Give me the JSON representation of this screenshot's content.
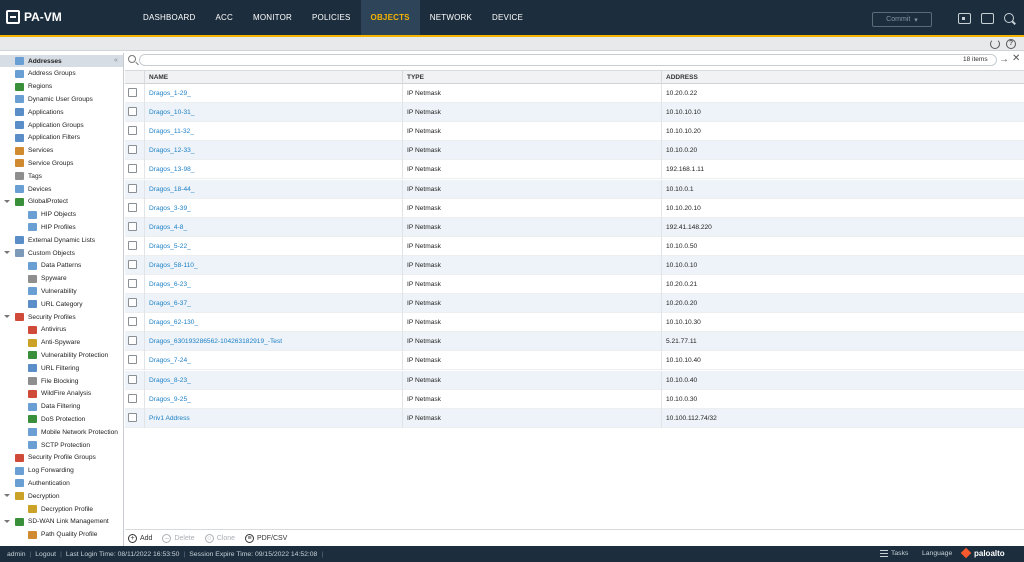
{
  "app": {
    "name": "PA-VM"
  },
  "nav": {
    "tabs": [
      "DASHBOARD",
      "ACC",
      "MONITOR",
      "POLICIES",
      "OBJECTS",
      "NETWORK",
      "DEVICE"
    ],
    "active": "OBJECTS"
  },
  "header": {
    "commit_label": "Commit"
  },
  "sidebar": {
    "items": [
      {
        "label": "Addresses",
        "color": "#6a9fd4"
      },
      {
        "label": "Address Groups",
        "color": "#6a9fd4"
      },
      {
        "label": "Regions",
        "color": "#3a8f3a"
      },
      {
        "label": "Dynamic User Groups",
        "color": "#6a9fd4"
      },
      {
        "label": "Applications",
        "color": "#5b8ec9"
      },
      {
        "label": "Application Groups",
        "color": "#5b8ec9"
      },
      {
        "label": "Application Filters",
        "color": "#5b8ec9"
      },
      {
        "label": "Services",
        "color": "#d08a2f"
      },
      {
        "label": "Service Groups",
        "color": "#d08a2f"
      },
      {
        "label": "Tags",
        "color": "#8e8e8e"
      },
      {
        "label": "Devices",
        "color": "#6a9fd4"
      },
      {
        "label": "GlobalProtect",
        "color": "#3a8f3a"
      },
      {
        "label": "HIP Objects",
        "color": "#6a9fd4"
      },
      {
        "label": "HIP Profiles",
        "color": "#6a9fd4"
      },
      {
        "label": "External Dynamic Lists",
        "color": "#5b8ec9"
      },
      {
        "label": "Custom Objects",
        "color": "#7d9ab8"
      },
      {
        "label": "Data Patterns",
        "color": "#6a9fd4"
      },
      {
        "label": "Spyware",
        "color": "#8e8e8e"
      },
      {
        "label": "Vulnerability",
        "color": "#6a9fd4"
      },
      {
        "label": "URL Category",
        "color": "#5b8ec9"
      },
      {
        "label": "Security Profiles",
        "color": "#d04a3a"
      },
      {
        "label": "Antivirus",
        "color": "#d04a3a"
      },
      {
        "label": "Anti-Spyware",
        "color": "#c9a227"
      },
      {
        "label": "Vulnerability Protection",
        "color": "#3a8f3a"
      },
      {
        "label": "URL Filtering",
        "color": "#5b8ec9"
      },
      {
        "label": "File Blocking",
        "color": "#8e8e8e"
      },
      {
        "label": "WildFire Analysis",
        "color": "#d04a3a"
      },
      {
        "label": "Data Filtering",
        "color": "#6a9fd4"
      },
      {
        "label": "DoS Protection",
        "color": "#3a8f3a"
      },
      {
        "label": "Mobile Network Protection",
        "color": "#6a9fd4"
      },
      {
        "label": "SCTP Protection",
        "color": "#6a9fd4"
      },
      {
        "label": "Security Profile Groups",
        "color": "#d04a3a"
      },
      {
        "label": "Log Forwarding",
        "color": "#6a9fd4"
      },
      {
        "label": "Authentication",
        "color": "#6a9fd4"
      },
      {
        "label": "Decryption",
        "color": "#c9a227"
      },
      {
        "label": "Decryption Profile",
        "color": "#c9a227"
      },
      {
        "label": "SD-WAN Link Management",
        "color": "#3a8f3a"
      },
      {
        "label": "Path Quality Profile",
        "color": "#d08a2f"
      }
    ]
  },
  "search": {
    "placeholder": "",
    "item_count": "18 items"
  },
  "table": {
    "columns": [
      "NAME",
      "TYPE",
      "ADDRESS"
    ],
    "rows": [
      [
        "Dragos_1-29_",
        "IP Netmask",
        "10.20.0.22"
      ],
      [
        "Dragos_10-31_",
        "IP Netmask",
        "10.10.10.10"
      ],
      [
        "Dragos_11-32_",
        "IP Netmask",
        "10.10.10.20"
      ],
      [
        "Dragos_12-33_",
        "IP Netmask",
        "10.10.0.20"
      ],
      [
        "Dragos_13-98_",
        "IP Netmask",
        "192.168.1.11"
      ],
      [
        "Dragos_18-44_",
        "IP Netmask",
        "10.10.0.1"
      ],
      [
        "Dragos_3-39_",
        "IP Netmask",
        "10.10.20.10"
      ],
      [
        "Dragos_4-8_",
        "IP Netmask",
        "192.41.148.220"
      ],
      [
        "Dragos_5-22_",
        "IP Netmask",
        "10.10.0.50"
      ],
      [
        "Dragos_58-110_",
        "IP Netmask",
        "10.10.0.10"
      ],
      [
        "Dragos_6-23_",
        "IP Netmask",
        "10.20.0.21"
      ],
      [
        "Dragos_6-37_",
        "IP Netmask",
        "10.20.0.20"
      ],
      [
        "Dragos_62-130_",
        "IP Netmask",
        "10.10.10.30"
      ],
      [
        "Dragos_630193286562-104263182919_-Test",
        "IP Netmask",
        "5.21.77.11"
      ],
      [
        "Dragos_7-24_",
        "IP Netmask",
        "10.10.10.40"
      ],
      [
        "Dragos_8-23_",
        "IP Netmask",
        "10.10.0.40"
      ],
      [
        "Dragos_9-25_",
        "IP Netmask",
        "10.10.0.30"
      ],
      [
        "Priv1 Address",
        "IP Netmask",
        "10.100.112.74/32"
      ]
    ]
  },
  "actions": {
    "add": "Add",
    "delete": "Delete",
    "clone": "Clone",
    "pdfcsv": "PDF/CSV"
  },
  "status": {
    "user": "admin",
    "logout": "Logout",
    "last_login": "Last Login Time: 08/11/2022 16:53:50",
    "session_expire": "Session Expire Time: 09/15/2022 14:52:08",
    "tasks": "Tasks",
    "language": "Language",
    "brand": "paloalto"
  }
}
